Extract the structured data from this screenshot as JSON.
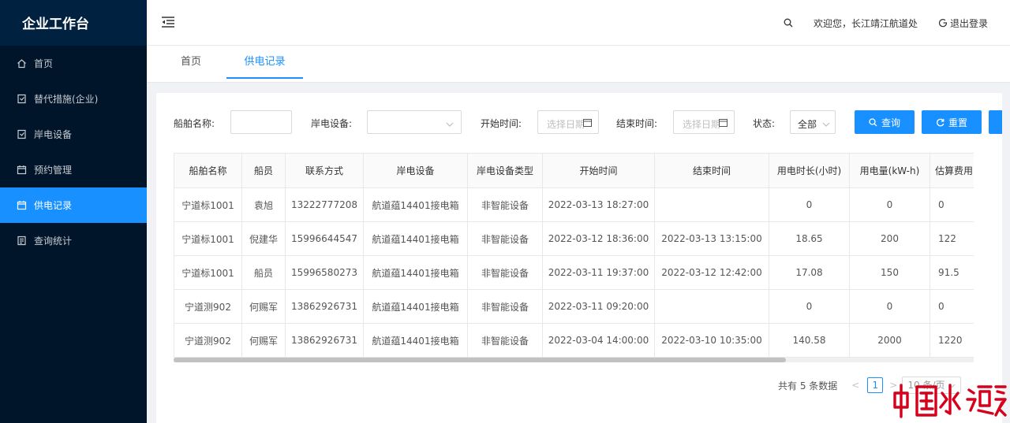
{
  "brand": "企业工作台",
  "sidebar": {
    "items": [
      {
        "label": "首页",
        "icon": "home-icon"
      },
      {
        "label": "替代措施(企业)",
        "icon": "doc-icon"
      },
      {
        "label": "岸电设备",
        "icon": "doc-icon"
      },
      {
        "label": "预约管理",
        "icon": "calendar-icon"
      },
      {
        "label": "供电记录",
        "icon": "calendar-icon",
        "active": true
      },
      {
        "label": "查询统计",
        "icon": "report-icon"
      }
    ]
  },
  "header": {
    "welcome": "欢迎您，长江靖江航道处",
    "logout": "退出登录"
  },
  "tabs": [
    "首页",
    "供电记录"
  ],
  "filter": {
    "ship_name_label": "船舶名称:",
    "device_label": "岸电设备:",
    "start_label": "开始时间:",
    "start_placeholder": "选择日期",
    "end_label": "结束时间:",
    "end_placeholder": "选择日期",
    "status_label": "状态:",
    "status_value": "全部",
    "search_button": "查询",
    "reset_button": "重置"
  },
  "table": {
    "columns": [
      "船舶名称",
      "船员",
      "联系方式",
      "岸电设备",
      "岸电设备类型",
      "开始时间",
      "结束时间",
      "用电时长(小时)",
      "用电量(kW-h)",
      "估算费用"
    ],
    "rows": [
      [
        "宁道标1001",
        "袁旭",
        "13222777208",
        "航道蕴14401接电箱",
        "非智能设备",
        "2022-03-13 18:27:00",
        "",
        "0",
        "0",
        "0"
      ],
      [
        "宁道标1001",
        "倪建华",
        "15996644547",
        "航道蕴14401接电箱",
        "非智能设备",
        "2022-03-12 18:36:00",
        "2022-03-13 13:15:00",
        "18.65",
        "200",
        "122"
      ],
      [
        "宁道标1001",
        "船员",
        "15996580273",
        "航道蕴14401接电箱",
        "非智能设备",
        "2022-03-11 19:37:00",
        "2022-03-12 12:42:00",
        "17.08",
        "150",
        "91.5"
      ],
      [
        "宁道测902",
        "何赐军",
        "13862926731",
        "航道蕴14401接电箱",
        "非智能设备",
        "2022-03-11 09:20:00",
        "",
        "0",
        "0",
        "0"
      ],
      [
        "宁道测902",
        "何赐军",
        "13862926731",
        "航道蕴14401接电箱",
        "非智能设备",
        "2022-03-04 14:00:00",
        "2022-03-10 10:35:00",
        "140.58",
        "2000",
        "1220"
      ]
    ]
  },
  "pagination": {
    "total": "共有 5 条数据",
    "prev": "<",
    "current": "1",
    "next": ">",
    "page_size": "10 条/页"
  },
  "watermark": "中国水运报",
  "colors": {
    "primary": "#1890ff",
    "sidebar_bg": "#001529",
    "watermark": "#d6001c"
  }
}
